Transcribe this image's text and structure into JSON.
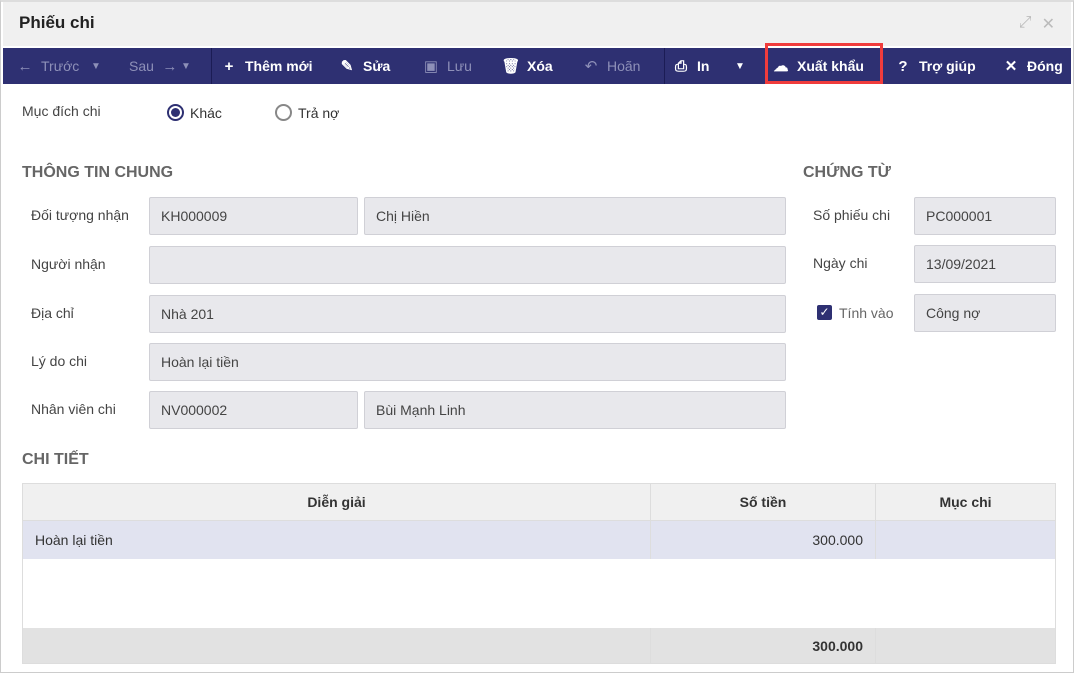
{
  "window": {
    "title": "Phiếu chi"
  },
  "toolbar": {
    "prev": "Trước",
    "next": "Sau",
    "add": "Thêm mới",
    "edit": "Sửa",
    "save": "Lưu",
    "delete": "Xóa",
    "undo": "Hoãn",
    "print": "In",
    "export": "Xuất khẩu",
    "help": "Trợ giúp",
    "close": "Đóng"
  },
  "purpose": {
    "label": "Mục đích chi",
    "options": [
      "Khác",
      "Trả nợ"
    ],
    "selected": "Khác"
  },
  "general": {
    "title": "THÔNG TIN CHUNG",
    "recipient_label": "Đối tượng nhận",
    "recipient_code": "KH000009",
    "recipient_name": "Chị Hiền",
    "receiver_label": "Người nhận",
    "receiver": "",
    "address_label": "Địa chỉ",
    "address": "Nhà 201",
    "reason_label": "Lý do chi",
    "reason": "Hoàn lại tiền",
    "staff_label": "Nhân viên chi",
    "staff_code": "NV000002",
    "staff_name": "Bùi Mạnh Linh"
  },
  "voucher": {
    "title": "CHỨNG TỪ",
    "number_label": "Số phiếu chi",
    "number": "PC000001",
    "date_label": "Ngày chi",
    "date": "13/09/2021",
    "include_label": "Tính vào",
    "include_checked": true,
    "include_value": "Công nợ"
  },
  "detail": {
    "title": "CHI TIẾT",
    "columns": [
      "Diễn giải",
      "Số tiền",
      "Mục chi"
    ],
    "rows": [
      {
        "desc": "Hoàn lại tiền",
        "amount": "300.000",
        "category": ""
      }
    ],
    "total": "300.000"
  },
  "colors": {
    "toolbar": "#2e3072",
    "highlight": "#f03c3c",
    "selected_row": "#e1e3f0"
  }
}
